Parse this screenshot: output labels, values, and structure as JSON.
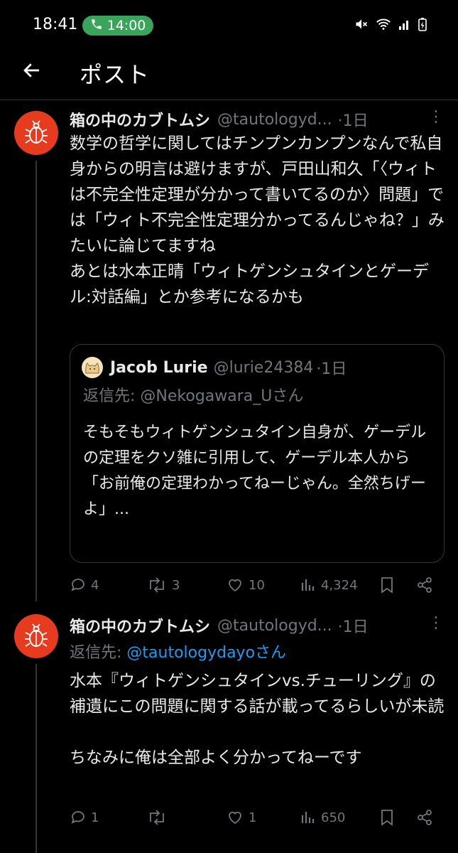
{
  "status_bar": {
    "time": "18:41",
    "call_time": "14:00"
  },
  "header": {
    "title": "ポスト"
  },
  "post1": {
    "name": "箱の中のカブトムシ",
    "handle": "@tautologyd...",
    "time": "·1日",
    "text": "数学の哲学に関してはチンプンカンプンなんで私自身からの明言は避けますが、戸田山和久「〈ウィトは不完全性定理が分かって書いてるのか〉問題」では「ウィト不完全性定理分かってるんじゃね？」みたいに論じてますね\nあとは水本正晴「ウィトゲンシュタインとゲーデル:対話編」とか参考になるかも",
    "quote": {
      "name": "Jacob Lurie",
      "handle": "@lurie24384",
      "time": "·1日",
      "reply_to": "返信先: @Nekogawara_Uさん",
      "text": "そもそもウィトゲンシュタイン自身が、ゲーデルの定理をクソ雑に引用して、ゲーデル本人から\n「お前俺の定理わかってねーじゃん。全然ちげーよ」..."
    },
    "stats": {
      "replies": "4",
      "reposts": "3",
      "likes": "10",
      "views": "4,324"
    }
  },
  "post2": {
    "name": "箱の中のカブトムシ",
    "handle": "@tautologyd...",
    "time": "·1日",
    "reply_prefix": "返信先: ",
    "reply_mention": "@tautologydayoさん",
    "text": "水本『ウィトゲンシュタインvs.チューリング』の補遺にこの問題に関する話が載ってるらしいが未読\n\nちなみに俺は全部よく分かってねーです",
    "stats": {
      "replies": "1",
      "reposts": "",
      "likes": "1",
      "views": "650"
    }
  }
}
